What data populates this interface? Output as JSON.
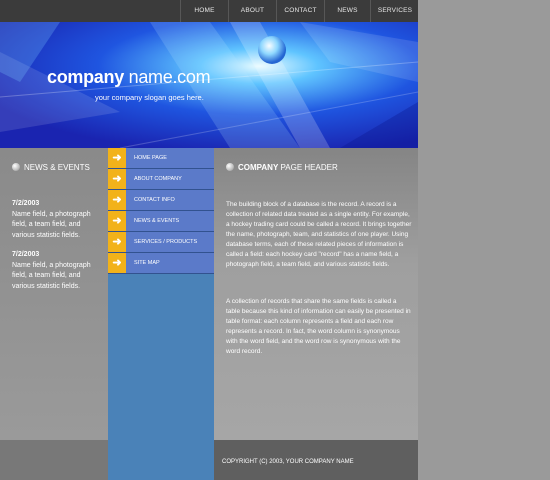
{
  "nav": [
    "HOME",
    "ABOUT",
    "CONTACT",
    "NEWS",
    "SERVICES"
  ],
  "banner": {
    "company_bold": "company",
    "company_rest": " name.com",
    "slogan": "your company slogan goes here."
  },
  "news": {
    "header": "NEWS & EVENTS",
    "items": [
      {
        "date": "7/2/2003",
        "text": "Name field, a photograph field, a team field, and various statistic fields."
      },
      {
        "date": "7/2/2003",
        "text": "Name field, a photograph field, a team field, and various statistic fields."
      }
    ]
  },
  "menu": [
    "HOME PAGE",
    "ABOUT COMPANY",
    "CONTACT INFO",
    "NEWS & EVENTS",
    "SERVICES / PRODUCTS",
    "SITE MAP"
  ],
  "main": {
    "header_bold": "COMPANY",
    "header_rest": " PAGE HEADER",
    "para1": "The building block of a database is the record. A record is a collection of related data treated as a single entity. For example, a hockey trading card could be called a record. It brings together the name, photograph, team, and statistics of one player. Using database terms, each of these related pieces of information is called a field: each hockey card \"record\" has a name field, a photograph field, a team field, and various statistic fields.",
    "para2": "A collection of records that share the same fields is called a table because this kind of information can easily be presented in table format: each column represents a field and each row represents a record. In fact, the word column is synonymous with the word field, and the word row is synonymous with the word record."
  },
  "footer": {
    "copyright": "COPYRIGHT (C) 2003, YOUR COMPANY NAME"
  },
  "colors": {
    "accent": "#f2b21a",
    "menu_bg": "#5b7ac9",
    "column_blue": "#4a82b8",
    "banner_blue": "#1a35c8"
  }
}
